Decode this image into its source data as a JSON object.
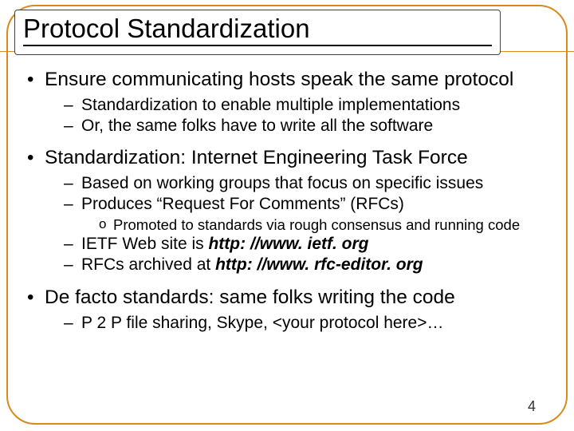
{
  "title": "Protocol Standardization",
  "page_number": "4",
  "bullets": [
    {
      "text": "Ensure communicating hosts speak the same protocol",
      "sub": [
        {
          "text": "Standardization to enable multiple implementations"
        },
        {
          "text": "Or, the same folks have to write all the software"
        }
      ]
    },
    {
      "text": "Standardization: Internet Engineering Task Force",
      "sub": [
        {
          "text": "Based on working groups that focus on specific issues"
        },
        {
          "text": "Produces “Request For Comments” (RFCs)",
          "subsub": [
            {
              "text": "Promoted to standards via rough consensus and running code"
            }
          ]
        },
        {
          "prefix": "IETF Web site is ",
          "emph": "http: //www. ietf. org"
        },
        {
          "prefix": "RFCs archived at ",
          "emph": "http: //www. rfc-editor. org"
        }
      ]
    },
    {
      "text": "De facto standards: same folks writing the code",
      "sub": [
        {
          "text": "P 2 P file sharing, Skype, <your protocol here>…"
        }
      ]
    }
  ]
}
